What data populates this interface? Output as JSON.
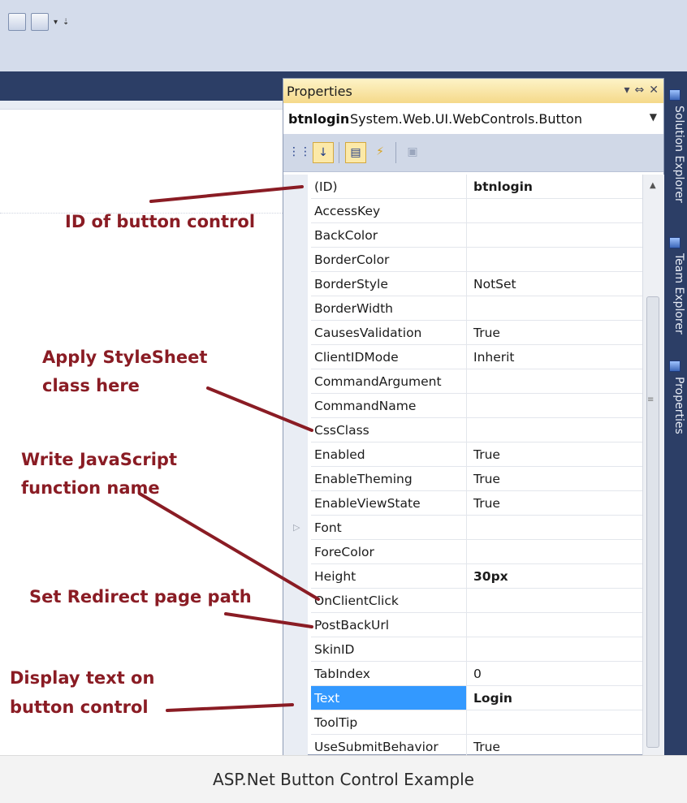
{
  "panel": {
    "title": "Properties",
    "window_buttons": [
      "▾",
      "⇔",
      "✕"
    ],
    "object_name": "btnlogin",
    "object_type": "System.Web.UI.WebControls.Button"
  },
  "properties": [
    {
      "name": "(ID)",
      "value": "btnlogin",
      "bold": true
    },
    {
      "name": "AccessKey",
      "value": ""
    },
    {
      "name": "BackColor",
      "value": ""
    },
    {
      "name": "BorderColor",
      "value": ""
    },
    {
      "name": "BorderStyle",
      "value": "NotSet"
    },
    {
      "name": "BorderWidth",
      "value": ""
    },
    {
      "name": "CausesValidation",
      "value": "True"
    },
    {
      "name": "ClientIDMode",
      "value": "Inherit"
    },
    {
      "name": "CommandArgument",
      "value": ""
    },
    {
      "name": "CommandName",
      "value": ""
    },
    {
      "name": "CssClass",
      "value": ""
    },
    {
      "name": "Enabled",
      "value": "True"
    },
    {
      "name": "EnableTheming",
      "value": "True"
    },
    {
      "name": "EnableViewState",
      "value": "True"
    },
    {
      "name": "Font",
      "value": "",
      "expandable": true
    },
    {
      "name": "ForeColor",
      "value": ""
    },
    {
      "name": "Height",
      "value": "30px",
      "bold": true
    },
    {
      "name": "OnClientClick",
      "value": ""
    },
    {
      "name": "PostBackUrl",
      "value": ""
    },
    {
      "name": "SkinID",
      "value": ""
    },
    {
      "name": "TabIndex",
      "value": "0"
    },
    {
      "name": "Text",
      "value": "Login",
      "bold": true,
      "selected": true
    },
    {
      "name": "ToolTip",
      "value": ""
    },
    {
      "name": "UseSubmitBehavior",
      "value": "True"
    }
  ],
  "side_tabs": [
    "Solution Explorer",
    "Team Explorer",
    "Properties"
  ],
  "annotations": {
    "id": "ID of button control",
    "css_line1": "Apply StyleSheet",
    "css_line2": "class here",
    "js_line1": "Write JavaScript",
    "js_line2": "function name",
    "redirect": "Set Redirect page path",
    "text_line1": "Display  text on",
    "text_line2": "button control"
  },
  "caption": "ASP.Net Button Control Example",
  "colors": {
    "annotation": "#8a1c24",
    "selection": "#3399ff",
    "ide_dark": "#2c3e66"
  }
}
